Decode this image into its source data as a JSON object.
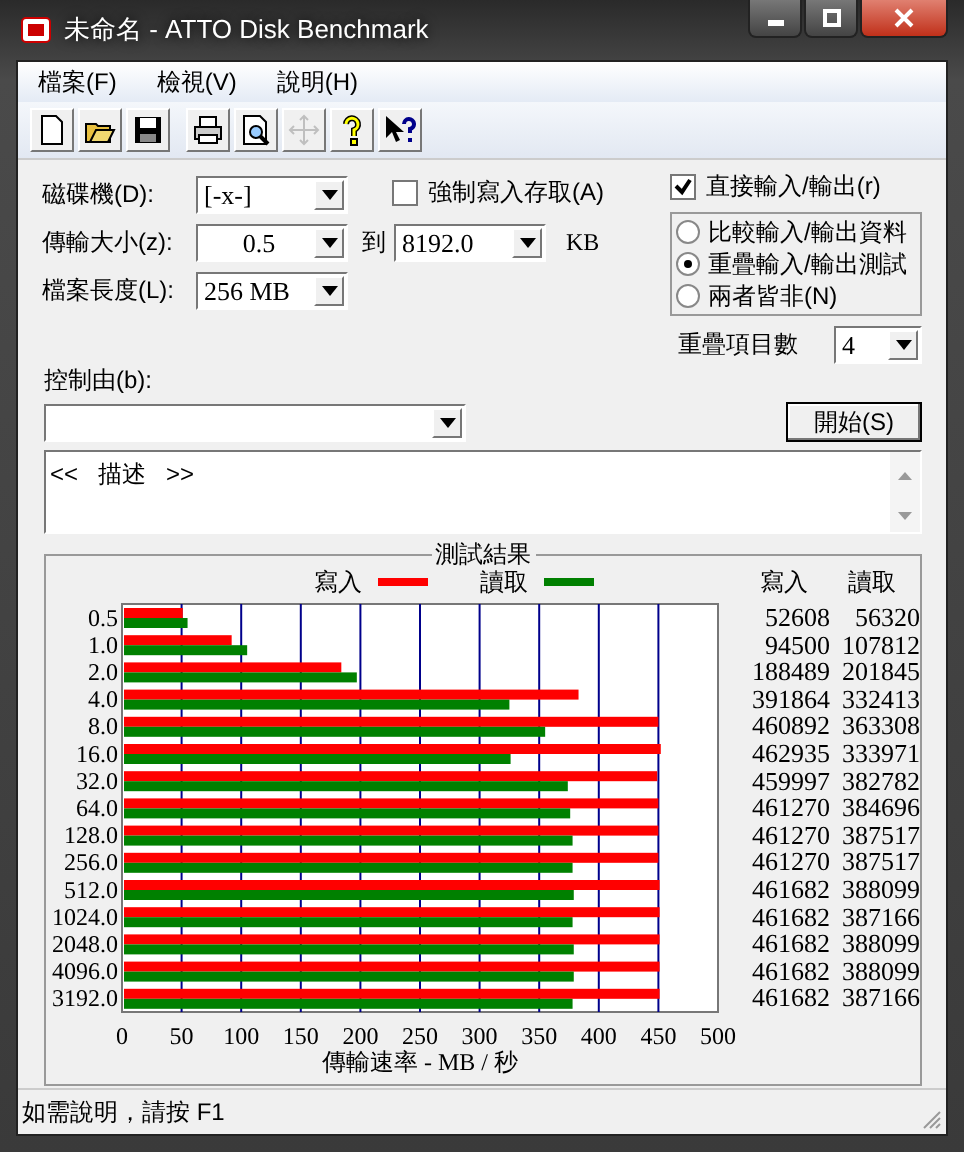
{
  "window": {
    "title": "未命名 - ATTO Disk Benchmark"
  },
  "menu": [
    "檔案(F)",
    "檢視(V)",
    "說明(H)"
  ],
  "toolbar": [
    {
      "kind": "new",
      "disabled": false
    },
    {
      "kind": "open",
      "disabled": false
    },
    {
      "kind": "save",
      "disabled": false
    },
    {
      "kind": "print",
      "disabled": false
    },
    {
      "kind": "preview",
      "disabled": false
    },
    {
      "kind": "move",
      "disabled": true
    },
    {
      "kind": "help",
      "disabled": false
    },
    {
      "kind": "context_help",
      "disabled": false
    }
  ],
  "form": {
    "drive": {
      "label": "磁碟機(D):",
      "value": "[-x-]"
    },
    "transfer_size": {
      "label": "傳輸大小(z):",
      "from": "0.5",
      "to_label": "到",
      "to": "8192.0",
      "unit": "KB"
    },
    "file_length": {
      "label": "檔案長度(L):",
      "value": "256 MB"
    },
    "force_write": {
      "label": "強制寫入存取(A)",
      "checked": false
    },
    "direct_io": {
      "label": "直接輸入/輸出(r)",
      "checked": true
    },
    "io_modes": [
      {
        "label": "比較輸入/輸出資料",
        "selected": false
      },
      {
        "label": "重疊輸入/輸出測試",
        "selected": true
      },
      {
        "label": "兩者皆非(N)",
        "selected": false
      }
    ],
    "queue_depth": {
      "label": "重疊項目數",
      "value": "4"
    },
    "controlled_by": {
      "label": "控制由(b):"
    },
    "start_button": "開始(S)",
    "description": "<<   描述   >>"
  },
  "results": {
    "title": "測試結果",
    "columns": [
      "寫入",
      "讀取"
    ],
    "rows": [
      {
        "write": "52608",
        "read": "56320"
      },
      {
        "write": "94500",
        "read": "107812"
      },
      {
        "write": "188489",
        "read": "201845"
      },
      {
        "write": "391864",
        "read": "332413"
      },
      {
        "write": "460892",
        "read": "363308"
      },
      {
        "write": "462935",
        "read": "333971"
      },
      {
        "write": "459997",
        "read": "382782"
      },
      {
        "write": "461270",
        "read": "384696"
      },
      {
        "write": "461270",
        "read": "387517"
      },
      {
        "write": "461270",
        "read": "387517"
      },
      {
        "write": "461682",
        "read": "388099"
      },
      {
        "write": "461682",
        "read": "387166"
      },
      {
        "write": "461682",
        "read": "388099"
      },
      {
        "write": "461682",
        "read": "388099"
      },
      {
        "write": "461682",
        "read": "387166"
      }
    ],
    "chart_data": {
      "type": "bar",
      "orientation": "horizontal",
      "grid": true,
      "xlabel": "傳輸速率 - MB / 秒",
      "categories": [
        "0.5",
        "1.0",
        "2.0",
        "4.0",
        "8.0",
        "16.0",
        "32.0",
        "64.0",
        "128.0",
        "256.0",
        "512.0",
        "1024.0",
        "2048.0",
        "4096.0",
        "3192.0"
      ],
      "series": [
        {
          "name": "寫入",
          "color": "#ff0000",
          "values": [
            51,
            92,
            184,
            383,
            450,
            452,
            449,
            450,
            450,
            450,
            451,
            451,
            451,
            451,
            451
          ]
        },
        {
          "name": "讀取",
          "color": "#008000",
          "values": [
            55,
            105,
            197,
            325,
            355,
            326,
            374,
            376,
            378,
            378,
            379,
            378,
            379,
            379,
            378
          ]
        }
      ],
      "xlim": [
        0,
        500
      ],
      "xticks": [
        0,
        50,
        100,
        150,
        200,
        250,
        300,
        350,
        400,
        450,
        500
      ]
    }
  },
  "status_bar": "如需說明，請按 F1"
}
